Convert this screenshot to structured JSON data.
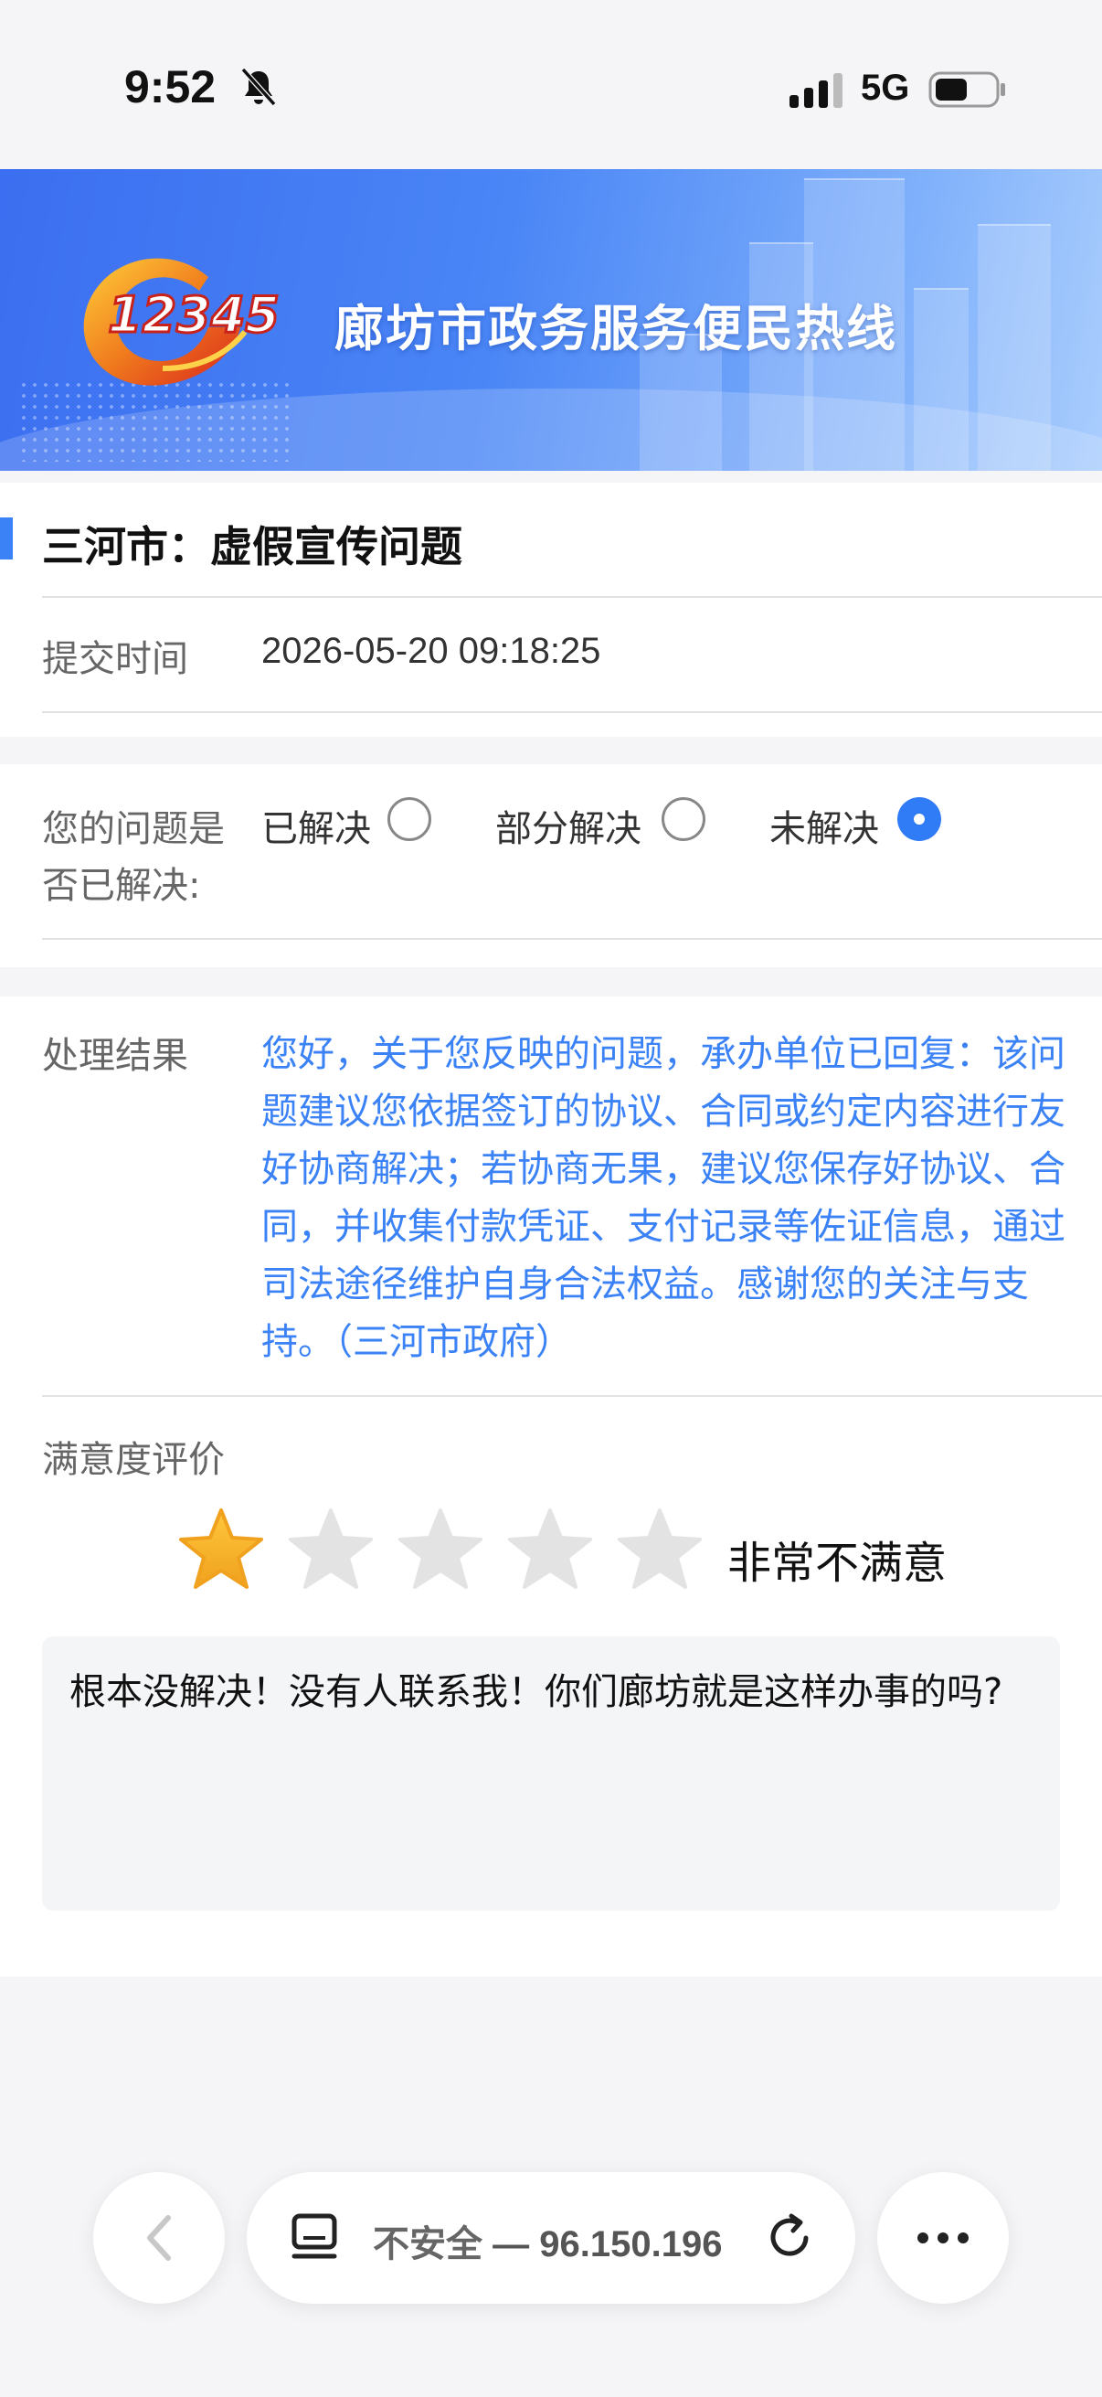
{
  "status_bar": {
    "time": "9:52",
    "network": "5G",
    "icons": [
      "bell-muted-icon",
      "signal-icon",
      "battery-icon"
    ]
  },
  "header": {
    "logo_text": "12345",
    "title": "廊坊市政务服务便民热线"
  },
  "issue": {
    "title": "三河市：虚假宣传问题",
    "submit_time_label": "提交时间",
    "submit_time": "2026-05-20 09:18:25"
  },
  "resolution": {
    "question_line1": "您的问题是",
    "question_line2": "否已解决:",
    "options": [
      {
        "label": "已解决",
        "selected": false
      },
      {
        "label": "部分解决",
        "selected": false
      },
      {
        "label": "未解决",
        "selected": true
      }
    ]
  },
  "result": {
    "label": "处理结果",
    "text": "您好，关于您反映的问题，承办单位已回复：该问题建议您依据签订的协议、合同或约定内容进行友好协商解决；若协商无果，建议您保存好协议、合同，并收集付款凭证、支付记录等佐证信息，通过司法途径维护自身合法权益。感谢您的关注与支持。（三河市政府）"
  },
  "rating": {
    "label": "满意度评价",
    "stars_max": 5,
    "stars_value": 1,
    "text": "非常不满意",
    "comment": "根本没解决！没有人联系我！你们廊坊就是这样办事的吗?"
  },
  "browser": {
    "security": "不安全",
    "separator": "—",
    "url": "96.150.196",
    "icons": [
      "back-icon",
      "page-format-icon",
      "reload-icon",
      "more-icon"
    ]
  },
  "colors": {
    "accent": "#3b82f6",
    "radio_selected": "#2f7cf6",
    "star_filled": "#f5b02e",
    "star_empty": "#e3e3e3",
    "banner": "#4a86f6"
  }
}
